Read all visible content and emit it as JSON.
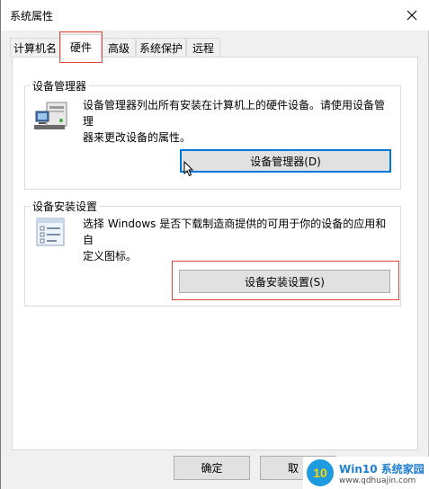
{
  "window": {
    "title": "系统属性"
  },
  "tabs": [
    {
      "label": "计算机名"
    },
    {
      "label": "硬件"
    },
    {
      "label": "高级"
    },
    {
      "label": "系统保护"
    },
    {
      "label": "远程"
    }
  ],
  "device_manager": {
    "group_label": "设备管理器",
    "description_line1": "设备管理器列出所有安装在计算机上的硬件设备。请使用设备管理",
    "description_line2": "器来更改设备的属性。",
    "button_label": "设备管理器(D)"
  },
  "device_install": {
    "group_label": "设备安装设置",
    "description_line1": "选择 Windows 是否下载制造商提供的可用于你的设备的应用和自",
    "description_line2": "定义图标。",
    "button_label": "设备安装设置(S)"
  },
  "footer": {
    "ok_label": "确定",
    "cancel_label": "取"
  },
  "watermark": {
    "brand": "Win10 系统家园",
    "url": "www.qdhuajin.com"
  },
  "colors": {
    "accent": "#0078d7",
    "highlight_red": "#e0463a"
  }
}
